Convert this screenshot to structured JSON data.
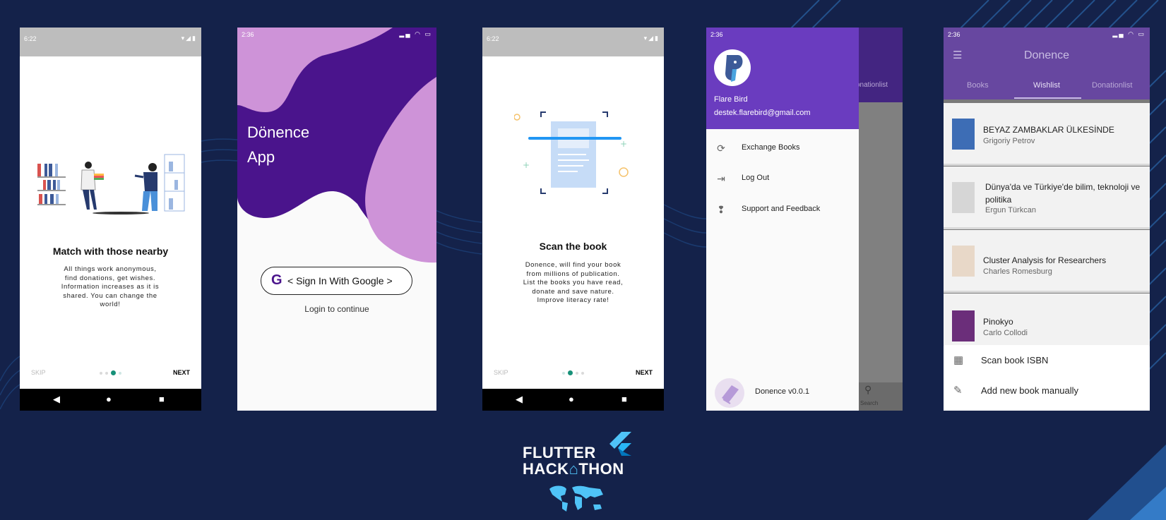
{
  "colors": {
    "background": "#14224a",
    "purple_primary": "#6a3cbf",
    "purple_dark": "#4a148c",
    "purple_light": "#ce93d8",
    "teal_accent": "#179179"
  },
  "screen1": {
    "status_time": "6:22",
    "title": "Match with those nearby",
    "description": "All things work anonymous, find donations, get wishes. Information increases as it is shared. You can change the world!",
    "skip_label": "SKIP",
    "next_label": "NEXT",
    "page_index": 3,
    "page_count": 4
  },
  "screen2": {
    "status_time": "2:36",
    "app_title_line1": "Dönence",
    "app_title_line2": "App",
    "google_button_label": "< Sign In With Google >",
    "login_hint": "Login to continue"
  },
  "screen3": {
    "status_time": "6:22",
    "title": "Scan the book",
    "description": "Donence, will find your book from millions of publication. List the books you have read, donate and save nature. Improve literacy rate!",
    "skip_label": "SKIP",
    "next_label": "NEXT",
    "page_index": 2,
    "page_count": 4
  },
  "screen4": {
    "status_time": "2:36",
    "user_name": "Flare Bird",
    "user_email": "destek.flarebird@gmail.com",
    "menu_items": [
      {
        "label": "Exchange Books",
        "icon": "refresh-icon"
      },
      {
        "label": "Log Out",
        "icon": "logout-icon"
      },
      {
        "label": "Support and Feedback",
        "icon": "feedback-icon"
      }
    ],
    "version_label": "Donence v0.0.1",
    "behind_tab_label": "onationlist",
    "behind_search_label": "Search"
  },
  "screen5": {
    "status_time": "2:36",
    "app_title": "Donence",
    "tabs": [
      "Books",
      "Wishlist",
      "Donationlist"
    ],
    "active_tab": "Wishlist",
    "books": [
      {
        "title": "BEYAZ ZAMBAKLAR ÜLKESİNDE",
        "author": "Grigoriy Petrov"
      },
      {
        "title": "Dünya'da ve Türkiye'de bilim, teknoloji ve politika",
        "author": "Ergun Türkcan"
      },
      {
        "title": "Cluster Analysis for Researchers",
        "author": "Charles Romesburg"
      },
      {
        "title": "Pinokyo",
        "author": "Carlo Collodi"
      }
    ],
    "sheet_options": [
      {
        "label": "Scan book ISBN",
        "icon": "qr-code-icon"
      },
      {
        "label": "Add new book manually",
        "icon": "pencil-icon"
      }
    ]
  },
  "branding": {
    "line1": "FLUTTER",
    "line2_part1": "HACK",
    "line2_part2": "THON"
  }
}
